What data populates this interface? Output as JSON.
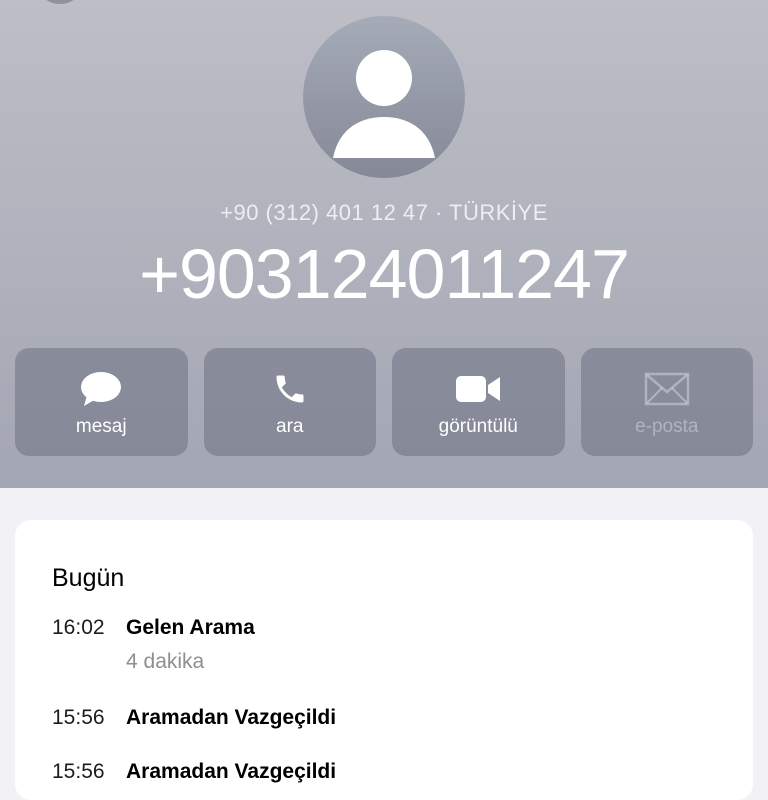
{
  "contact": {
    "subtitle": "+90 (312) 401 12 47 · TÜRKİYE",
    "number": "+903124011247"
  },
  "actions": [
    {
      "label": "mesaj",
      "icon": "message-bubble-icon",
      "enabled": true
    },
    {
      "label": "ara",
      "icon": "phone-icon",
      "enabled": true
    },
    {
      "label": "görüntülü",
      "icon": "video-camera-icon",
      "enabled": true
    },
    {
      "label": "e-posta",
      "icon": "envelope-icon",
      "enabled": false
    }
  ],
  "history": {
    "title": "Bugün",
    "calls": [
      {
        "time": "16:02",
        "type": "Gelen Arama",
        "duration": "4 dakika"
      },
      {
        "time": "15:56",
        "type": "Aramadan Vazgeçildi"
      },
      {
        "time": "15:56",
        "type": "Aramadan Vazgeçildi"
      }
    ]
  },
  "colors": {
    "header_top": "#bdbec6",
    "header_bottom": "#a3a6b3",
    "button_bg": "#868a99",
    "page_bg": "#f2f2f6"
  }
}
